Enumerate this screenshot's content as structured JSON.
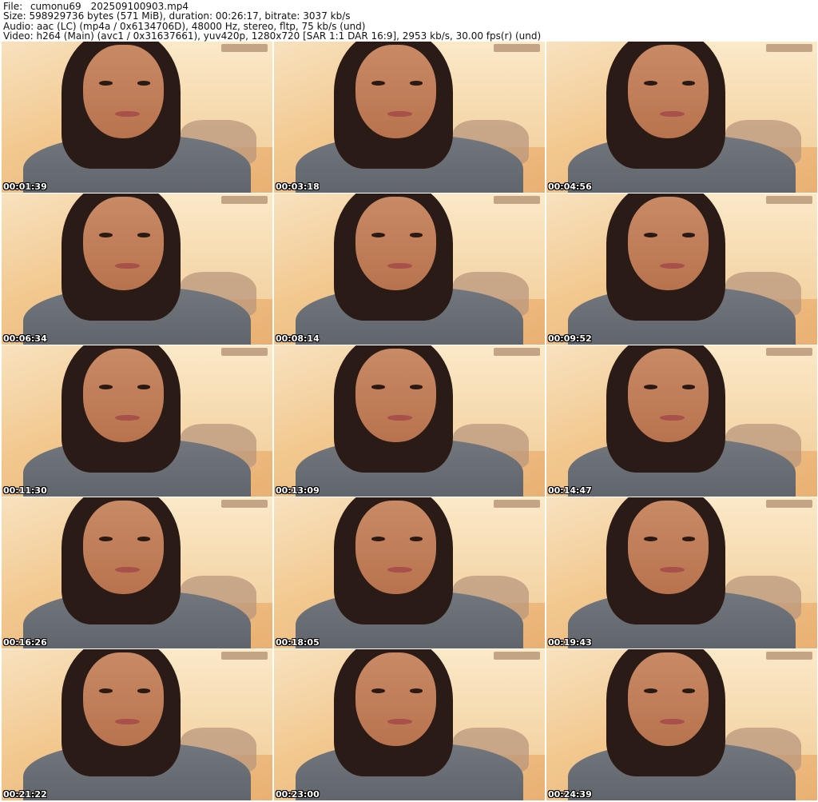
{
  "header": {
    "file_line": "File: _cumonu69__202509100903.mp4",
    "size_line": "Size: 598929736 bytes (571 MiB), duration: 00:26:17, bitrate: 3037 kb/s",
    "audio_line": "Audio: aac (LC) (mp4a / 0x6134706D), 48000 Hz, stereo, fltp, 75 kb/s (und)",
    "video_line": "Video: h264 (Main) (avc1 / 0x31637661), yuv420p, 1280x720 [SAR 1:1 DAR 16:9], 2953 kb/s, 30.00 fps(r) (und)"
  },
  "thumbnails": [
    {
      "timestamp": "00:01:39"
    },
    {
      "timestamp": "00:03:18"
    },
    {
      "timestamp": "00:04:56"
    },
    {
      "timestamp": "00:06:34"
    },
    {
      "timestamp": "00:08:14"
    },
    {
      "timestamp": "00:09:52"
    },
    {
      "timestamp": "00:11:30"
    },
    {
      "timestamp": "00:13:09"
    },
    {
      "timestamp": "00:14:47"
    },
    {
      "timestamp": "00:16:26"
    },
    {
      "timestamp": "00:18:05"
    },
    {
      "timestamp": "00:19:43"
    },
    {
      "timestamp": "00:21:22"
    },
    {
      "timestamp": "00:23:00"
    },
    {
      "timestamp": "00:24:39"
    }
  ],
  "colors": {
    "timestamp_text": "#ffffff",
    "timestamp_outline": "#000000",
    "header_text": "#111111",
    "background": "#ffffff"
  }
}
